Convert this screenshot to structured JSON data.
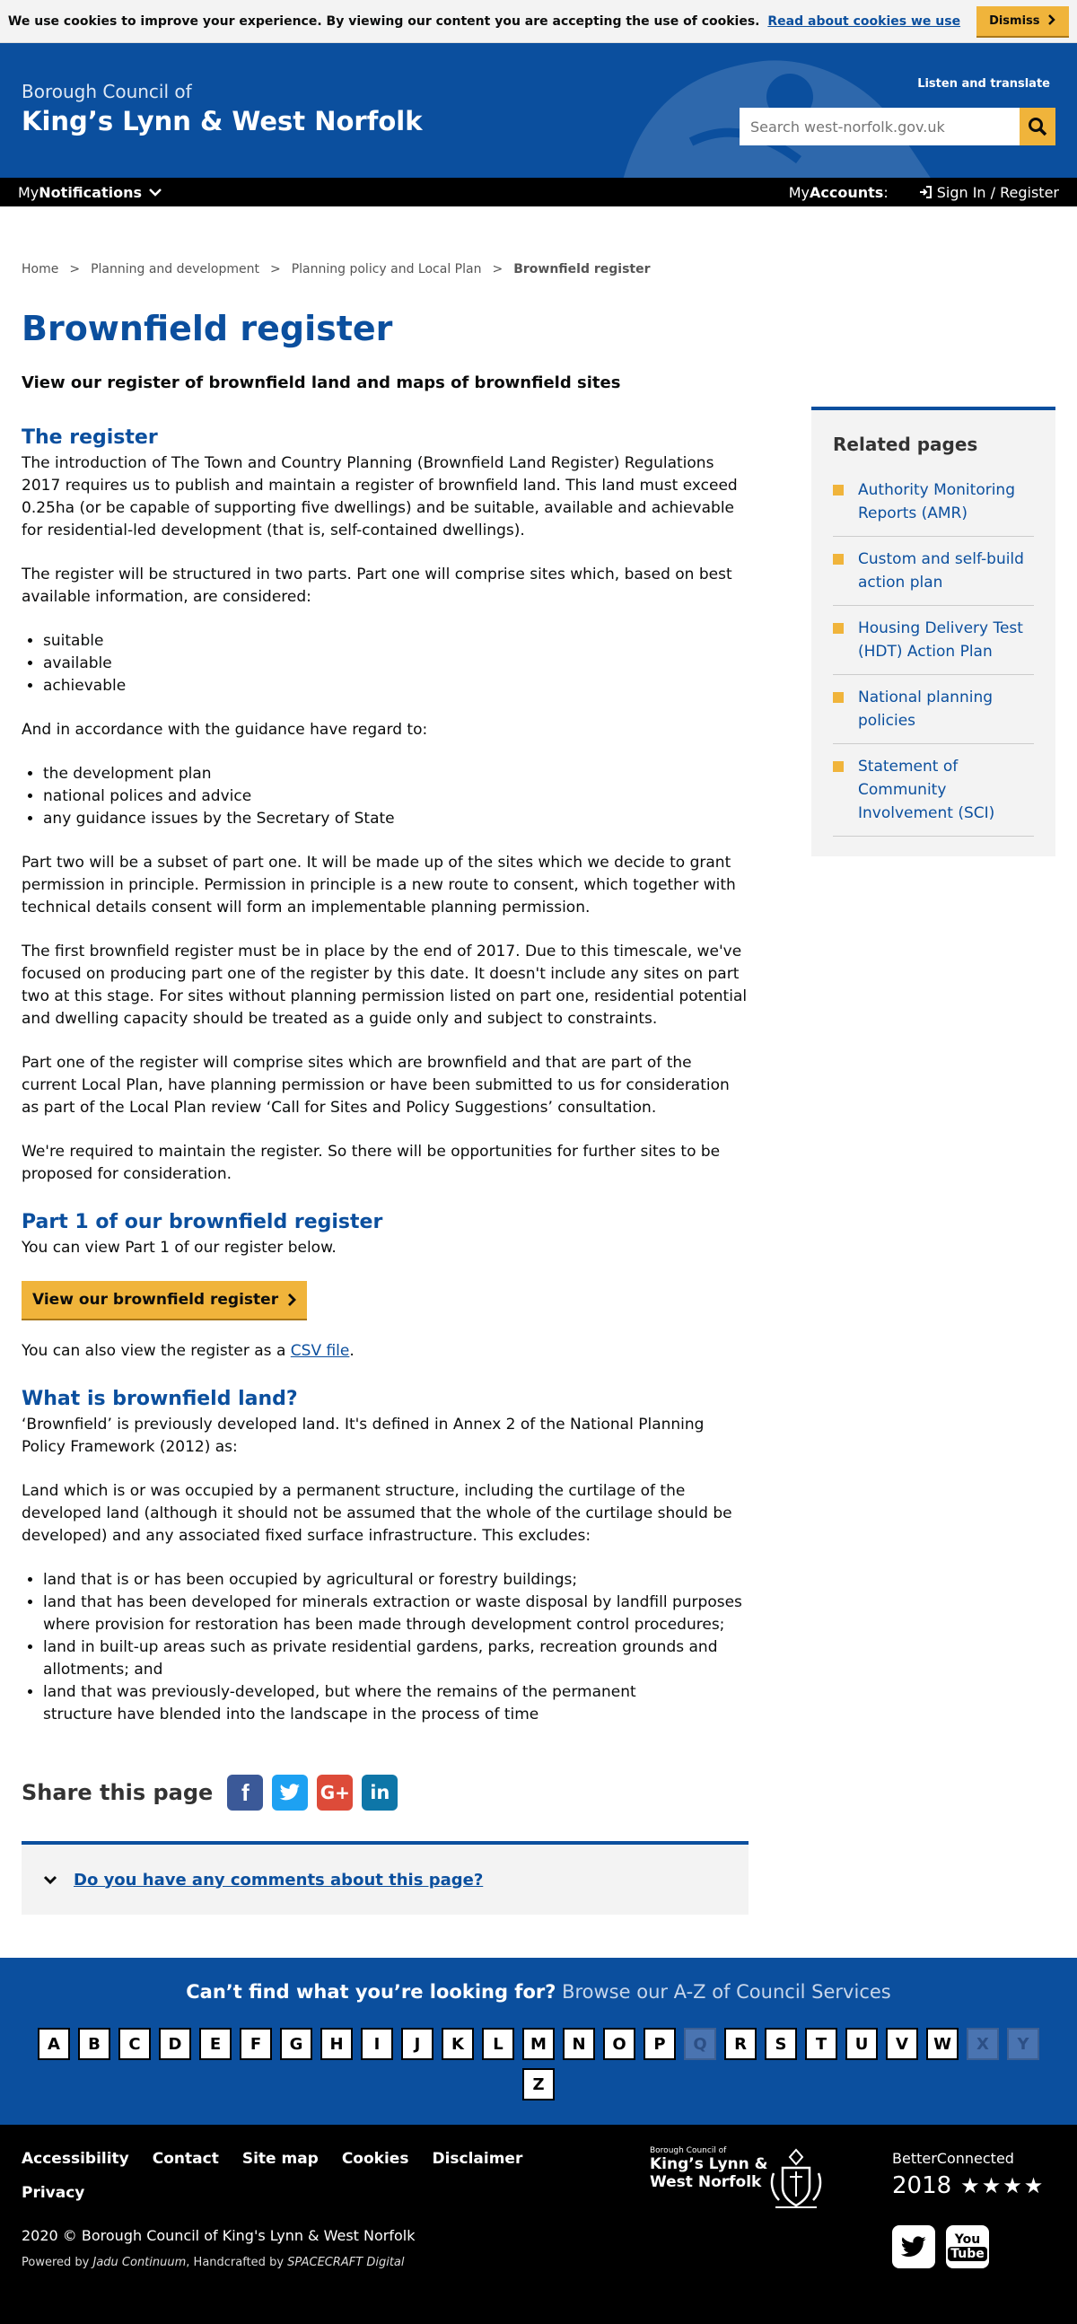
{
  "cookie": {
    "message": "We use cookies to improve your experience. By viewing our content you are accepting the use of cookies.",
    "link": "Read about cookies we use",
    "dismiss": "Dismiss"
  },
  "header": {
    "brand_line1": "Borough Council of",
    "brand_line2": "King’s Lynn & West Norfolk",
    "listen": "Listen and translate",
    "search_placeholder": "Search west-norfolk.gov.uk"
  },
  "account_bar": {
    "notifications_prefix": "My",
    "notifications": "Notifications",
    "accounts_prefix": "My",
    "accounts": "Accounts",
    "accounts_suffix": ":",
    "signin": "Sign In / Register"
  },
  "breadcrumb": {
    "home": "Home",
    "planning": "Planning and development",
    "policy": "Planning policy and Local Plan",
    "current": "Brownfield register",
    "sep": ">"
  },
  "page": {
    "title": "Brownfield register",
    "lede": "View our register of brownfield land and maps of brownfield sites"
  },
  "register": {
    "heading": "The register",
    "p1": "The introduction of The Town and Country Planning (Brownfield Land Register) Regulations 2017 requires us to publish and maintain a register of brownfield land. This land must exceed 0.25ha (or be capable of supporting five dwellings) and be suitable, available and achievable for residential-led development (that is, self-contained dwellings).",
    "p2": "The register will be structured in two parts. Part one will comprise sites which, based on best available information, are considered:",
    "list1": [
      "suitable",
      "available",
      "achievable"
    ],
    "p3": "And in accordance with the guidance have regard to:",
    "list2": [
      "the development plan",
      "national polices and advice",
      "any guidance issues by the Secretary of State"
    ],
    "p4": "Part two will be a subset of part one. It will be made up of the sites which we decide to grant permission in principle. Permission in principle is a new route to consent, which together with technical details consent will form an implementable planning permission.",
    "p5": "The first brownfield register must be in place by the end of 2017. Due to this timescale, we've focused on producing part one of the register by this date. It doesn't include any sites on part two at this stage. For sites without planning permission listed on part one, residential potential and dwelling capacity should be treated as a guide only and subject to constraints.",
    "p6": "Part one of the register will comprise sites which are brownfield and that are part of the current Local Plan, have planning permission or have been submitted to us for consideration as part of the Local Plan review ‘Call for Sites and Policy Suggestions’ consultation.",
    "p7": "We're required to maintain the register. So there will be opportunities for further sites to be proposed for consideration."
  },
  "part1": {
    "heading": "Part 1 of our brownfield register",
    "p1": "You can view Part 1 of our register below.",
    "button": "View our brownfield register",
    "csv_prefix": "You can also view the register as a ",
    "csv_link": "CSV file",
    "csv_suffix": "."
  },
  "brownfield": {
    "heading": "What is brownfield land?",
    "p1": "‘Brownfield’ is previously developed land. It's defined in Annex 2 of the National Planning Policy Framework (2012) as:",
    "p2": "Land which is or was occupied by a permanent structure, including the curtilage of the developed land (although it should not be assumed that the whole of the curtilage should be developed) and any associated fixed surface infrastructure. This excludes:",
    "list": [
      "land that is or has been occupied by agricultural or forestry buildings;",
      "land that has been developed for minerals extraction or waste disposal by landfill purposes where provision for restoration has been made through development control procedures;",
      "land in built-up areas such as private residential gardens, parks, recreation grounds and allotments; and",
      "land that was previously-developed, but where the remains of the permanent structure have blended into the landscape in the process of time"
    ]
  },
  "share": {
    "label": "Share this page",
    "colors": {
      "facebook": "#3b5998",
      "twitter": "#1da1f2",
      "google": "#dd4b39",
      "linkedin": "#0e76a8"
    },
    "icons": [
      "facebook-icon",
      "twitter-icon",
      "google-plus-icon",
      "linkedin-icon"
    ]
  },
  "comments": {
    "link": "Do you have any comments about this page?"
  },
  "related": {
    "heading": "Related pages",
    "items": [
      "Authority Monitoring Reports (AMR)",
      "Custom and self-build action plan",
      "Housing Delivery Test (HDT) Action Plan",
      "National planning policies",
      "Statement of Community Involvement (SCI)"
    ]
  },
  "az": {
    "title_bold": "Can’t find what you’re looking for?",
    "title_rest": " Browse our A-Z of Council Services",
    "letters": [
      {
        "l": "A",
        "on": true
      },
      {
        "l": "B",
        "on": true
      },
      {
        "l": "C",
        "on": true
      },
      {
        "l": "D",
        "on": true
      },
      {
        "l": "E",
        "on": true
      },
      {
        "l": "F",
        "on": true
      },
      {
        "l": "G",
        "on": true
      },
      {
        "l": "H",
        "on": true
      },
      {
        "l": "I",
        "on": true
      },
      {
        "l": "J",
        "on": true
      },
      {
        "l": "K",
        "on": true
      },
      {
        "l": "L",
        "on": true
      },
      {
        "l": "M",
        "on": true
      },
      {
        "l": "N",
        "on": true
      },
      {
        "l": "O",
        "on": true
      },
      {
        "l": "P",
        "on": true
      },
      {
        "l": "Q",
        "on": false
      },
      {
        "l": "R",
        "on": true
      },
      {
        "l": "S",
        "on": true
      },
      {
        "l": "T",
        "on": true
      },
      {
        "l": "U",
        "on": true
      },
      {
        "l": "V",
        "on": true
      },
      {
        "l": "W",
        "on": true
      },
      {
        "l": "X",
        "on": false
      },
      {
        "l": "Y",
        "on": false
      },
      {
        "l": "Z",
        "on": true
      }
    ]
  },
  "footer": {
    "links": [
      "Accessibility",
      "Contact",
      "Site map",
      "Cookies",
      "Disclaimer",
      "Privacy"
    ],
    "copyright": "2020 © Borough Council of King's Lynn & West Norfolk",
    "powered_prefix": "Powered by ",
    "powered_a": "Jadu Continuum",
    "powered_mid": ", Handcrafted by ",
    "powered_b": "SPACECRAFT Digital",
    "logo_line1": "Borough Council of",
    "logo_line2": "King’s Lynn &",
    "logo_line3": "West Norfolk",
    "better": "BetterConnected",
    "better_year": "2018",
    "better_stars": "★★★★",
    "twitter": "twitter-icon",
    "youtube_top": "You",
    "youtube_bottom": "Tube"
  }
}
